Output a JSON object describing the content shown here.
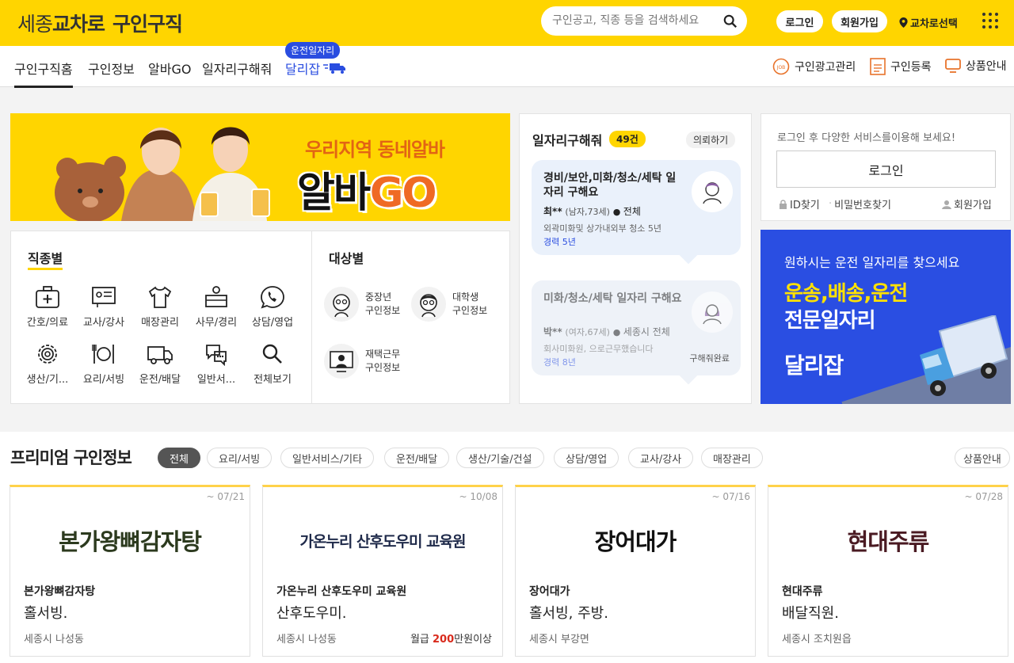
{
  "header": {
    "logo_prefix": "세종",
    "logo_brand": "교차로",
    "logo_suffix": "구인구직",
    "search_placeholder": "구인공고, 직종 등을 검색하세요",
    "login_label": "로그인",
    "signup_label": "회원가입",
    "location_label": "교차로선택"
  },
  "nav": {
    "tabs": [
      "구인구직홈",
      "구인정보",
      "알바GO",
      "일자리구해줘",
      "달리잡"
    ],
    "badge": "운전일자리",
    "right_links": [
      "구인광고관리",
      "구인등록",
      "상품안내"
    ]
  },
  "banner": {
    "line1": "우리지역 동네알바",
    "line2_a": "알바",
    "line2_b": "GO"
  },
  "categories": {
    "by_job_title": "직종별",
    "by_target_title": "대상별",
    "jobs": [
      "간호/의료",
      "교사/강사",
      "매장관리",
      "사무/경리",
      "상담/영업",
      "생산/기...",
      "요리/서빙",
      "운전/배달",
      "일반서...",
      "전체보기"
    ],
    "targets": [
      {
        "label": "중장년",
        "sub": "구인정보"
      },
      {
        "label": "대학생",
        "sub": "구인정보"
      },
      {
        "label": "재택근무",
        "sub": "구인정보"
      }
    ]
  },
  "seekers": {
    "title": "일자리구해줘",
    "count": "49건",
    "request_label": "의뢰하기",
    "cards": [
      {
        "title": "경비/보안,미화/청소/세탁 일자리 구해요",
        "name": "최**",
        "info": "(남자,73세)",
        "area": "전체",
        "desc": "외곽미화및 상가내외부 청소 5년",
        "exp": "경력 5년",
        "done": ""
      },
      {
        "title": "미화/청소/세탁 일자리 구해요",
        "name": "박**",
        "info": "(여자,67세)",
        "area": "세종시 전체",
        "desc": "회사미화원, 으로근무했습니다",
        "exp": "경력 8년",
        "done": "구해줘완료"
      }
    ]
  },
  "login_box": {
    "message": "로그인 후 다양한 서비스를이용해 보세요!",
    "button": "로그인",
    "links": [
      "ID찾기",
      "비밀번호찾기",
      "회원가입"
    ]
  },
  "ad": {
    "line1": "원하시는 운전 일자리를 찾으세요",
    "line2": "운송,배송,운전",
    "line3": "전문일자리",
    "brand": "달리잡"
  },
  "premium": {
    "title": "프리미엄 구인정보",
    "filters": [
      "전체",
      "요리/서빙",
      "일반서비스/기타",
      "운전/배달",
      "생산/기술/건설",
      "상담/영업",
      "교사/강사",
      "매장관리"
    ],
    "product_info": "상품안내",
    "jobs": [
      {
        "deadline": "~ 07/21",
        "logo": "본가왕뼈감자탕",
        "company": "본가왕뼈감자탕",
        "position": "홀서빙.",
        "area": "세종시 나성동",
        "pay_label": "",
        "pay_value": "",
        "pay_unit": ""
      },
      {
        "deadline": "~ 10/08",
        "logo": "가온누리 산후도우미 교육원",
        "company": "가온누리 산후도우미 교육원",
        "position": "산후도우미.",
        "area": "세종시 나성동",
        "pay_label": "월급 ",
        "pay_value": "200",
        "pay_unit": "만원이상"
      },
      {
        "deadline": "~ 07/16",
        "logo": "장어대가",
        "company": "장어대가",
        "position": "홀서빙, 주방.",
        "area": "세종시 부강면",
        "pay_label": "",
        "pay_value": "",
        "pay_unit": ""
      },
      {
        "deadline": "~ 07/28",
        "logo": "현대주류",
        "company": "현대주류",
        "position": "배달직원.",
        "area": "세종시 조치원읍",
        "pay_label": "",
        "pay_value": "",
        "pay_unit": ""
      }
    ]
  },
  "colors": {
    "brand_yellow": "#ffd500",
    "accent_blue": "#2a4de0",
    "pay_red": "#d92a1c"
  }
}
